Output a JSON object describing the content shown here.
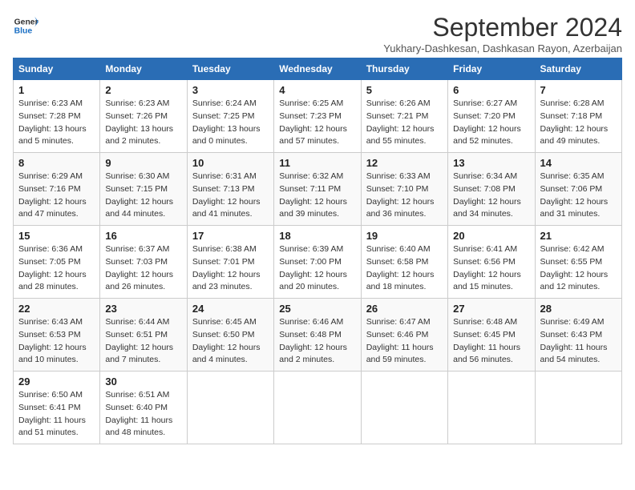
{
  "logo": {
    "line1": "General",
    "line2": "Blue"
  },
  "title": "September 2024",
  "location": "Yukhary-Dashkesan, Dashkasan Rayon, Azerbaijan",
  "weekdays": [
    "Sunday",
    "Monday",
    "Tuesday",
    "Wednesday",
    "Thursday",
    "Friday",
    "Saturday"
  ],
  "weeks": [
    [
      {
        "day": "1",
        "sunrise": "6:23 AM",
        "sunset": "7:28 PM",
        "daylight": "13 hours and 5 minutes."
      },
      {
        "day": "2",
        "sunrise": "6:23 AM",
        "sunset": "7:26 PM",
        "daylight": "13 hours and 2 minutes."
      },
      {
        "day": "3",
        "sunrise": "6:24 AM",
        "sunset": "7:25 PM",
        "daylight": "13 hours and 0 minutes."
      },
      {
        "day": "4",
        "sunrise": "6:25 AM",
        "sunset": "7:23 PM",
        "daylight": "12 hours and 57 minutes."
      },
      {
        "day": "5",
        "sunrise": "6:26 AM",
        "sunset": "7:21 PM",
        "daylight": "12 hours and 55 minutes."
      },
      {
        "day": "6",
        "sunrise": "6:27 AM",
        "sunset": "7:20 PM",
        "daylight": "12 hours and 52 minutes."
      },
      {
        "day": "7",
        "sunrise": "6:28 AM",
        "sunset": "7:18 PM",
        "daylight": "12 hours and 49 minutes."
      }
    ],
    [
      {
        "day": "8",
        "sunrise": "6:29 AM",
        "sunset": "7:16 PM",
        "daylight": "12 hours and 47 minutes."
      },
      {
        "day": "9",
        "sunrise": "6:30 AM",
        "sunset": "7:15 PM",
        "daylight": "12 hours and 44 minutes."
      },
      {
        "day": "10",
        "sunrise": "6:31 AM",
        "sunset": "7:13 PM",
        "daylight": "12 hours and 41 minutes."
      },
      {
        "day": "11",
        "sunrise": "6:32 AM",
        "sunset": "7:11 PM",
        "daylight": "12 hours and 39 minutes."
      },
      {
        "day": "12",
        "sunrise": "6:33 AM",
        "sunset": "7:10 PM",
        "daylight": "12 hours and 36 minutes."
      },
      {
        "day": "13",
        "sunrise": "6:34 AM",
        "sunset": "7:08 PM",
        "daylight": "12 hours and 34 minutes."
      },
      {
        "day": "14",
        "sunrise": "6:35 AM",
        "sunset": "7:06 PM",
        "daylight": "12 hours and 31 minutes."
      }
    ],
    [
      {
        "day": "15",
        "sunrise": "6:36 AM",
        "sunset": "7:05 PM",
        "daylight": "12 hours and 28 minutes."
      },
      {
        "day": "16",
        "sunrise": "6:37 AM",
        "sunset": "7:03 PM",
        "daylight": "12 hours and 26 minutes."
      },
      {
        "day": "17",
        "sunrise": "6:38 AM",
        "sunset": "7:01 PM",
        "daylight": "12 hours and 23 minutes."
      },
      {
        "day": "18",
        "sunrise": "6:39 AM",
        "sunset": "7:00 PM",
        "daylight": "12 hours and 20 minutes."
      },
      {
        "day": "19",
        "sunrise": "6:40 AM",
        "sunset": "6:58 PM",
        "daylight": "12 hours and 18 minutes."
      },
      {
        "day": "20",
        "sunrise": "6:41 AM",
        "sunset": "6:56 PM",
        "daylight": "12 hours and 15 minutes."
      },
      {
        "day": "21",
        "sunrise": "6:42 AM",
        "sunset": "6:55 PM",
        "daylight": "12 hours and 12 minutes."
      }
    ],
    [
      {
        "day": "22",
        "sunrise": "6:43 AM",
        "sunset": "6:53 PM",
        "daylight": "12 hours and 10 minutes."
      },
      {
        "day": "23",
        "sunrise": "6:44 AM",
        "sunset": "6:51 PM",
        "daylight": "12 hours and 7 minutes."
      },
      {
        "day": "24",
        "sunrise": "6:45 AM",
        "sunset": "6:50 PM",
        "daylight": "12 hours and 4 minutes."
      },
      {
        "day": "25",
        "sunrise": "6:46 AM",
        "sunset": "6:48 PM",
        "daylight": "12 hours and 2 minutes."
      },
      {
        "day": "26",
        "sunrise": "6:47 AM",
        "sunset": "6:46 PM",
        "daylight": "11 hours and 59 minutes."
      },
      {
        "day": "27",
        "sunrise": "6:48 AM",
        "sunset": "6:45 PM",
        "daylight": "11 hours and 56 minutes."
      },
      {
        "day": "28",
        "sunrise": "6:49 AM",
        "sunset": "6:43 PM",
        "daylight": "11 hours and 54 minutes."
      }
    ],
    [
      {
        "day": "29",
        "sunrise": "6:50 AM",
        "sunset": "6:41 PM",
        "daylight": "11 hours and 51 minutes."
      },
      {
        "day": "30",
        "sunrise": "6:51 AM",
        "sunset": "6:40 PM",
        "daylight": "11 hours and 48 minutes."
      },
      null,
      null,
      null,
      null,
      null
    ]
  ]
}
